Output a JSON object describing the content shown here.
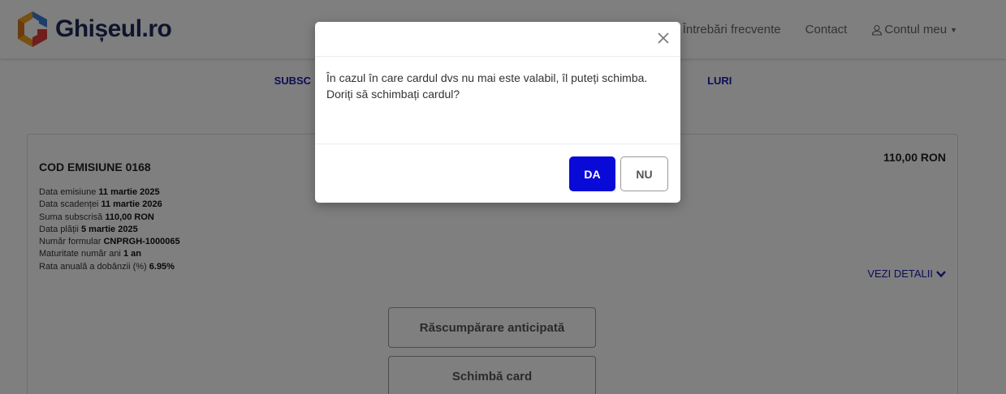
{
  "brand": {
    "name": "Ghișeul.ro"
  },
  "nav": {
    "faq": "Întrebări frecvente",
    "contact": "Contact",
    "account": "Contul meu"
  },
  "tabs": [
    "SUBSC",
    "LURI"
  ],
  "card": {
    "title": "COD EMISIUNE 0168",
    "amount": "110,00 RON",
    "details": [
      {
        "label": "Data emisiune",
        "value": "11 martie 2025"
      },
      {
        "label": "Data scadenței",
        "value": "11 martie 2026"
      },
      {
        "label": "Suma subscrisă",
        "value": "110,00 RON"
      },
      {
        "label": "Data plății",
        "value": "5 martie 2025"
      },
      {
        "label": "Număr formular",
        "value": "CNPRGH-1000065"
      },
      {
        "label": "Maturitate număr ani",
        "value": "1 an"
      },
      {
        "label": "Rata anuală a dobânzii (%)",
        "value": "6.95%"
      }
    ],
    "see_details": "VEZI DETALII",
    "early_redemption": "Răscumpărare anticipată",
    "change_card": "Schimbă card"
  },
  "modal": {
    "message": "În cazul în care cardul dvs nu mai este valabil, îl puteți schimba. Doriți să schimbați cardul?",
    "yes": "DA",
    "no": "NU"
  },
  "colors": {
    "accent": "#0a0ad8",
    "link": "#1a1ab0",
    "brand_text": "#1d2a5a"
  },
  "icons": {
    "logo": "ghiseul-logo-icon",
    "user": "user-icon",
    "caret": "caret-down-icon",
    "chevron": "chevron-down-icon",
    "close": "close-icon"
  }
}
